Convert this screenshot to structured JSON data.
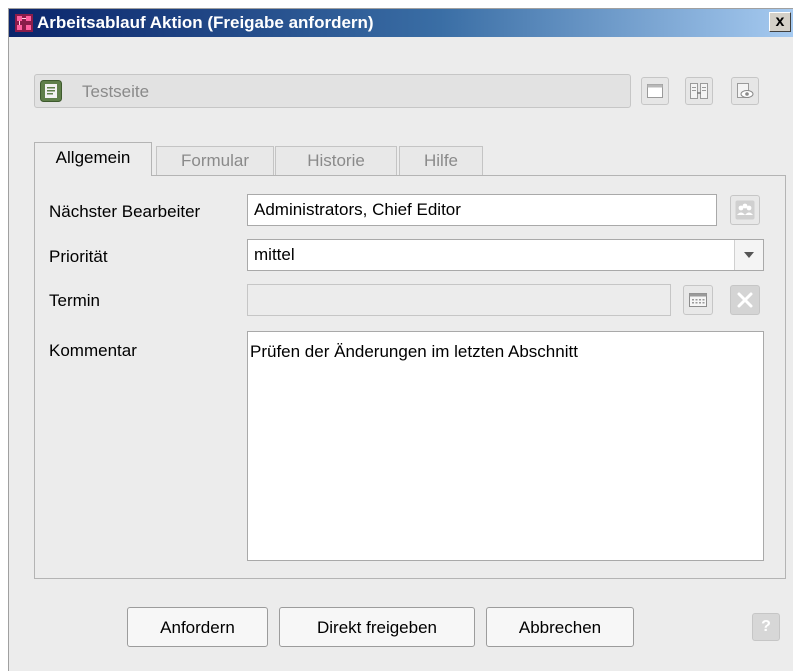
{
  "window": {
    "title": "Arbeitsablauf Aktion (Freigabe anfordern)",
    "close_label": "x"
  },
  "object": {
    "name": "Testseite"
  },
  "tabs": [
    {
      "label": "Allgemein",
      "active": true
    },
    {
      "label": "Formular",
      "active": false
    },
    {
      "label": "Historie",
      "active": false
    },
    {
      "label": "Hilfe",
      "active": false
    }
  ],
  "form": {
    "next_editor": {
      "label": "Nächster Bearbeiter",
      "value": "Administrators, Chief Editor"
    },
    "priority": {
      "label": "Priorität",
      "value": "mittel"
    },
    "deadline": {
      "label": "Termin",
      "value": ""
    },
    "comment": {
      "label": "Kommentar",
      "value": "Prüfen der Änderungen im letzten Abschnitt"
    }
  },
  "buttons": {
    "request": "Anfordern",
    "direct_release": "Direkt freigeben",
    "cancel": "Abbrechen",
    "help": "?"
  },
  "icons": {
    "title": "workflow-icon",
    "object": "page-document-icon",
    "toolbar": [
      "window-icon",
      "compare-icon",
      "preview-icon"
    ],
    "user_picker": "group-icon",
    "calendar": "calendar-icon",
    "clear": "clear-x-icon"
  },
  "colors": {
    "titlebar_start": "#0a246a",
    "titlebar_end": "#a6caf0",
    "dialog_bg": "#ececec"
  }
}
